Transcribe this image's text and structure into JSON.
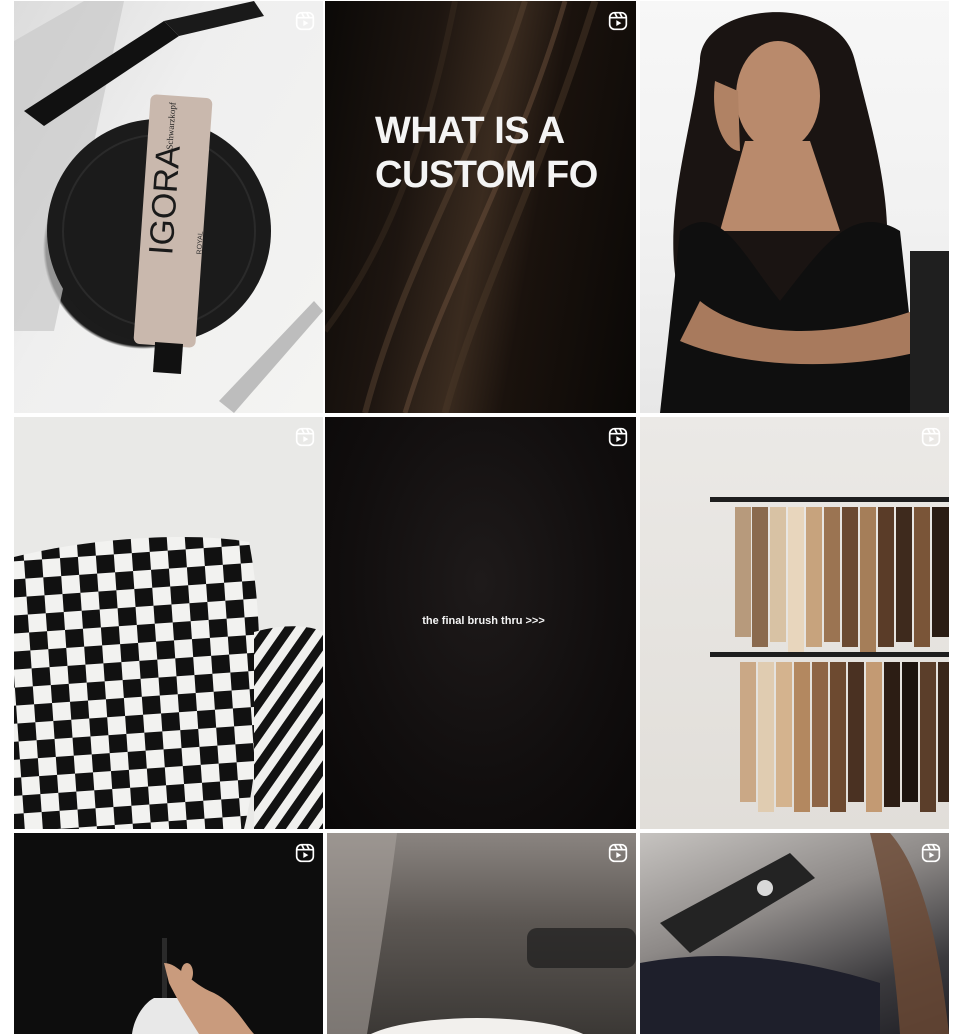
{
  "grid": {
    "tiles": [
      {
        "id": "tile-1",
        "reel": true,
        "caption": ""
      },
      {
        "id": "tile-2",
        "reel": true,
        "caption": "WHAT IS A\nCUSTOM FO"
      },
      {
        "id": "tile-3",
        "reel": false,
        "caption": ""
      },
      {
        "id": "tile-4",
        "reel": true,
        "caption": ""
      },
      {
        "id": "tile-5",
        "reel": true,
        "caption": "the final brush thru >>>"
      },
      {
        "id": "tile-6",
        "reel": true,
        "caption": ""
      },
      {
        "id": "tile-7",
        "reel": true,
        "caption": ""
      },
      {
        "id": "tile-8",
        "reel": true,
        "caption": ""
      },
      {
        "id": "tile-9",
        "reel": true,
        "caption": ""
      }
    ]
  },
  "photo_text": {
    "tube_brand": "Schwarzkopf",
    "tube_product": "IGORA",
    "tube_line": "ROYAL"
  },
  "colors": {
    "page_background": "#ffffff",
    "reel_icon": "#ffffff"
  },
  "icons": {
    "reel": "reels-icon"
  }
}
